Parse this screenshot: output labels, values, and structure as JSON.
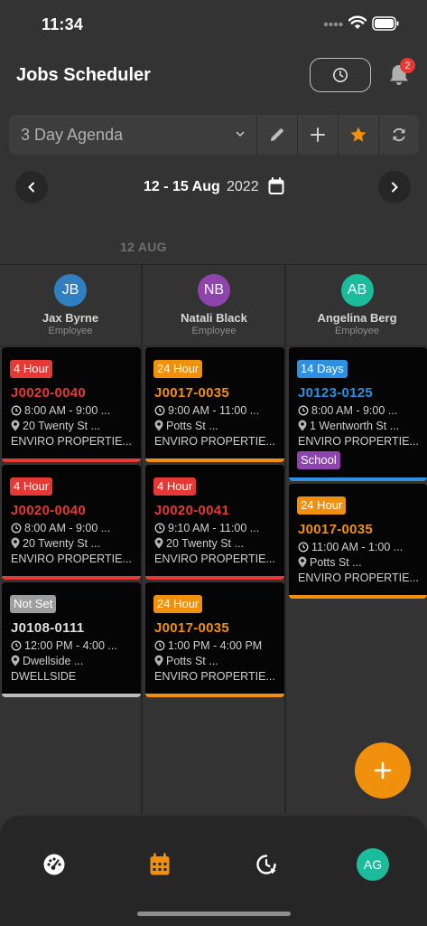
{
  "status": {
    "time": "11:34"
  },
  "header": {
    "title": "Jobs Scheduler",
    "notification_count": "2"
  },
  "toolbar": {
    "view_selected": "3 Day Agenda"
  },
  "date_nav": {
    "range": "12 - 15 Aug",
    "year": "2022"
  },
  "day_label": "12 AUG",
  "employees": [
    {
      "initials": "JB",
      "name": "Jax Byrne",
      "role": "Employee",
      "color": "#2f7fc1"
    },
    {
      "initials": "NB",
      "name": "Natali Black",
      "role": "Employee",
      "color": "#8e44ad"
    },
    {
      "initials": "AB",
      "name": "Angelina Berg",
      "role": "Employee",
      "color": "#1abc9c"
    }
  ],
  "columns": [
    [
      {
        "tag": "4 Hour",
        "tag_color": "#e53935",
        "job": "J0020-0040",
        "job_color": "#e53935",
        "time": "8:00 AM - 9:00 ...",
        "address": "20 Twenty St ...",
        "client": "ENVIRO PROPERTIE...",
        "bar_color": "#e53935"
      },
      {
        "tag": "4 Hour",
        "tag_color": "#e53935",
        "job": "J0020-0040",
        "job_color": "#e53935",
        "time": "8:00 AM - 9:00 ...",
        "address": "20 Twenty St ...",
        "client": "ENVIRO PROPERTIE...",
        "bar_color": "#e53935"
      },
      {
        "tag": "Not Set",
        "tag_color": "#9e9e9e",
        "job": "J0108-0111",
        "job_color": "#e0e0e0",
        "time": "12:00 PM - 4:00 ...",
        "address": "Dwellside ...",
        "client": "DWELLSIDE",
        "bar_color": "#bdbdbd"
      }
    ],
    [
      {
        "tag": "24 Hour",
        "tag_color": "#f0900c",
        "job": "J0017-0035",
        "job_color": "#f0900c",
        "time": "9:00 AM - 11:00 ...",
        "address": "Potts St ...",
        "client": "ENVIRO PROPERTIE...",
        "bar_color": "#f0900c"
      },
      {
        "tag": "4 Hour",
        "tag_color": "#e53935",
        "job": "J0020-0041",
        "job_color": "#e53935",
        "time": "9:10 AM - 11:00 ...",
        "address": "20 Twenty St ...",
        "client": "ENVIRO PROPERTIE...",
        "bar_color": "#e53935"
      },
      {
        "tag": "24 Hour",
        "tag_color": "#f0900c",
        "job": "J0017-0035",
        "job_color": "#f0900c",
        "time": "1:00 PM - 4:00 PM",
        "address": "Potts St ...",
        "client": "ENVIRO PROPERTIE...",
        "bar_color": "#f0900c"
      }
    ],
    [
      {
        "tag": "14 Days",
        "tag_color": "#2f8fe0",
        "job": "J0123-0125",
        "job_color": "#2f8fe0",
        "time": "8:00 AM - 9:00 ...",
        "address": "1 Wentworth St ...",
        "client": "ENVIRO PROPERTIE...",
        "bar_color": "#2f8fe0",
        "extra_tag": "School"
      },
      {
        "tag": "24 Hour",
        "tag_color": "#f0900c",
        "job": "J0017-0035",
        "job_color": "#f0900c",
        "time": "11:00 AM - 1:00 ...",
        "address": "Potts St ...",
        "client": "ENVIRO PROPERTIE...",
        "bar_color": "#f0900c"
      }
    ]
  ],
  "bottom_nav": {
    "profile_initials": "AG"
  }
}
